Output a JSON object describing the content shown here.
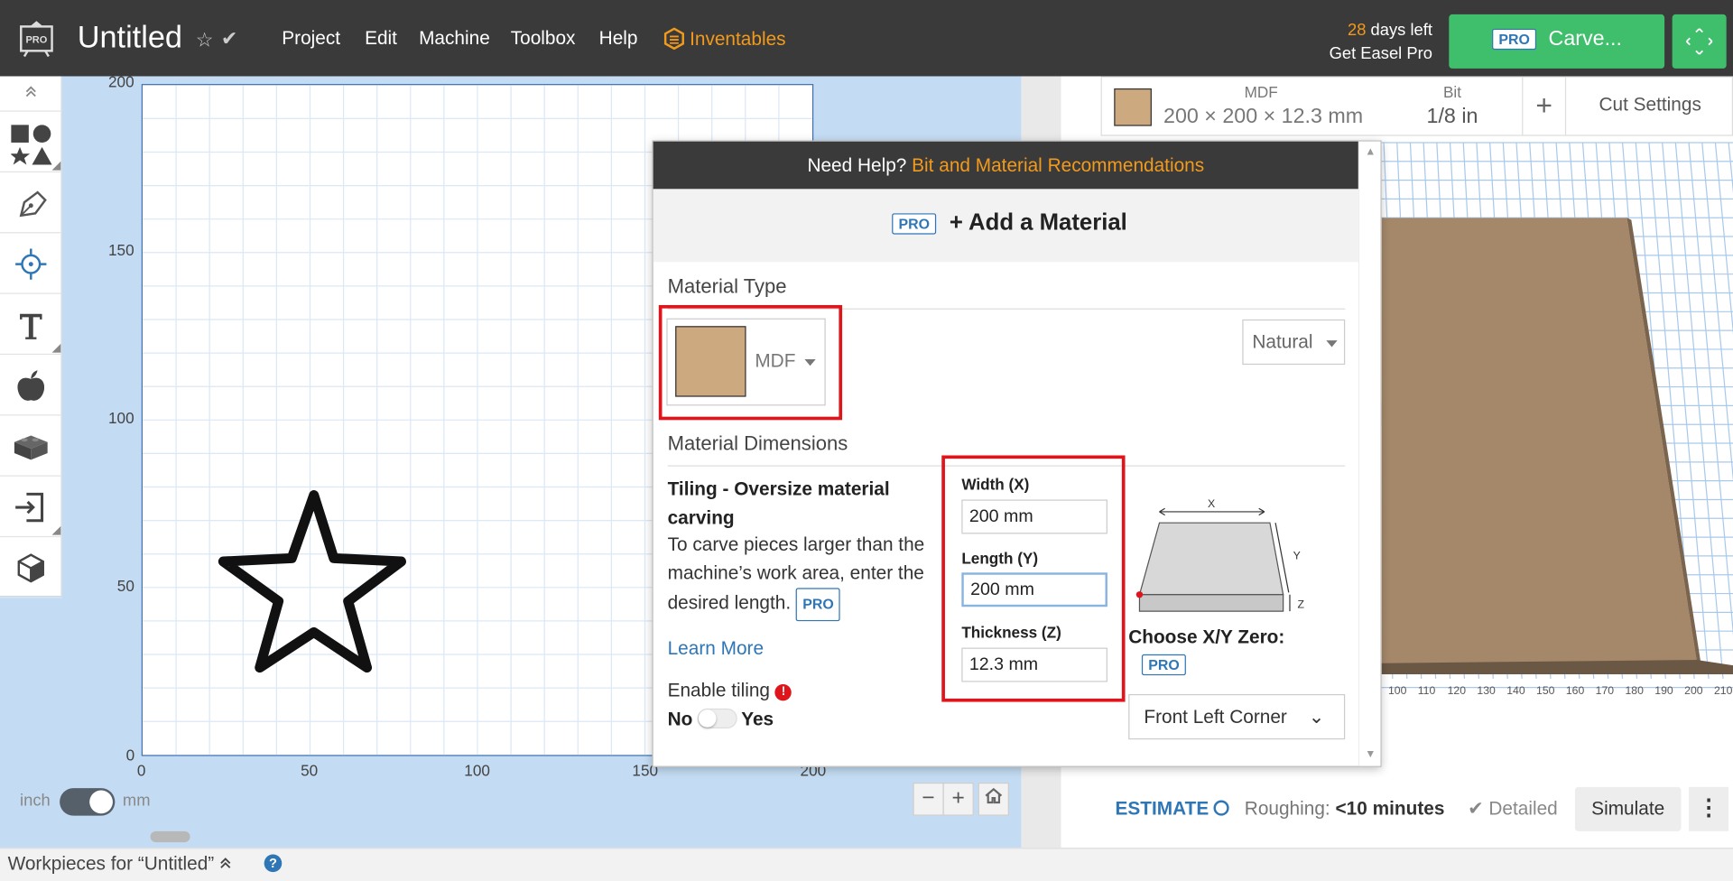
{
  "topbar": {
    "logo_label": "PRO",
    "title": "Untitled",
    "menu": [
      "Project",
      "Edit",
      "Machine",
      "Toolbox",
      "Help"
    ],
    "inventables": "Inventables",
    "trial_days": "28",
    "trial_suffix": " days left",
    "get_pro": "Get Easel Pro",
    "carve_pro_badge": "PRO",
    "carve_label": "Carve..."
  },
  "canvas": {
    "y_ticks": [
      "200",
      "150",
      "100",
      "50",
      "0"
    ],
    "x_ticks": [
      "0",
      "50",
      "100",
      "150",
      "200"
    ],
    "unit_left": "inch",
    "unit_right": "mm"
  },
  "bottombar": {
    "workpieces": "Workpieces for “Untitled”",
    "help": "?"
  },
  "material_bar": {
    "material_label": "MDF",
    "dimensions": "200 × 200 × 12.3 mm",
    "bit_label": "Bit",
    "bit_value": "1/8 in",
    "add": "+",
    "cut_settings": "Cut Settings"
  },
  "preview_ruler": [
    "100",
    "110",
    "120",
    "130",
    "140",
    "150",
    "160",
    "170",
    "180",
    "190",
    "200",
    "210"
  ],
  "estimate": {
    "label": "ESTIMATE",
    "roughing_label": "Roughing:",
    "roughing_value": "<10 minutes",
    "detailed": "Detailed",
    "simulate": "Simulate",
    "more": "⋮"
  },
  "modal": {
    "help_prefix": "Need Help?",
    "help_link": "Bit and Material Recommendations",
    "add_pro_badge": "PRO",
    "add_material": "+ Add a Material",
    "material_type_heading": "Material Type",
    "material_type_value": "MDF",
    "material_type_color": "#cda97f",
    "finish_value": "Natural",
    "dimensions_heading": "Material Dimensions",
    "tiling_title": "Tiling - Oversize material carving",
    "tiling_desc": "To carve pieces larger than the machine’s work area, enter the desired length.",
    "tiling_pro_badge": "PRO",
    "learn_more": "Learn More",
    "enable_tiling": "Enable tiling",
    "no": "No",
    "yes": "Yes",
    "width_label": "Width (X)",
    "width_value": "200 mm",
    "length_label": "Length (Y)",
    "length_value": "200 mm",
    "thickness_label": "Thickness (Z)",
    "thickness_value": "12.3 mm",
    "diagram_x": "X",
    "diagram_y": "Y",
    "diagram_z": "Z",
    "choose_zero": "Choose X/Y Zero:",
    "zero_pro_badge": "PRO",
    "zero_value": "Front Left Corner"
  },
  "colors": {
    "accent_orange": "#f29a1c",
    "carve_green": "#3fbf6c",
    "link_blue": "#2f76b6",
    "highlight_red": "#e0141b"
  }
}
